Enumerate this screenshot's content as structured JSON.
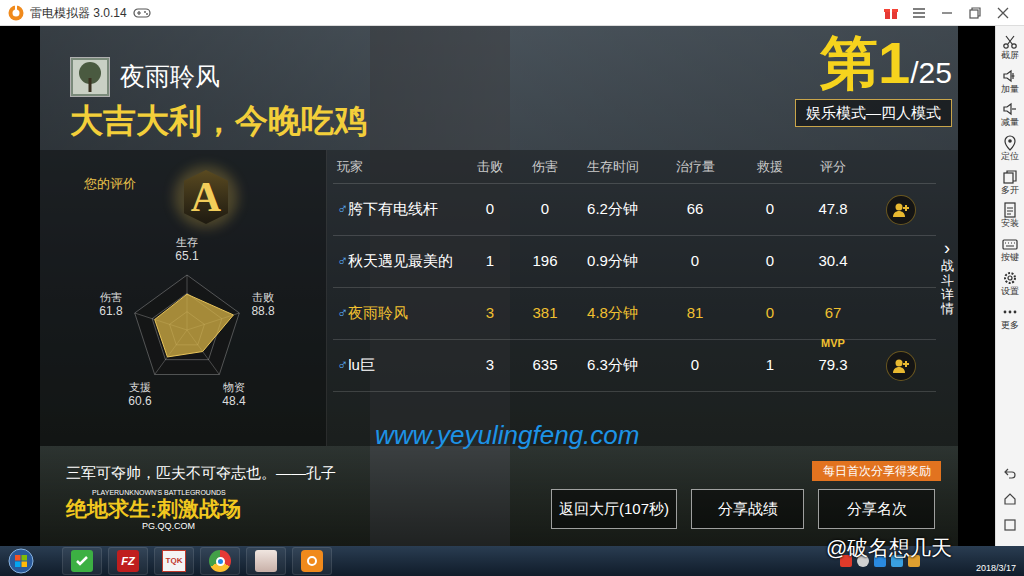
{
  "emulator": {
    "title": "雷电模拟器 3.0.14",
    "sidebar": [
      {
        "label": "截屏",
        "kind": "scissors"
      },
      {
        "label": "加量",
        "kind": "volup"
      },
      {
        "label": "减量",
        "kind": "voldown"
      },
      {
        "label": "定位",
        "kind": "location"
      },
      {
        "label": "多开",
        "kind": "multi"
      },
      {
        "label": "安装",
        "kind": "apk"
      },
      {
        "label": "按键",
        "kind": "keyboard"
      },
      {
        "label": "设置",
        "kind": "gear"
      },
      {
        "label": "更多",
        "kind": "more"
      }
    ]
  },
  "header": {
    "player": "夜雨聆风",
    "slogan": "大吉大利，今晚吃鸡",
    "rank": "第1",
    "total": "/25",
    "mode": "娱乐模式—四人模式"
  },
  "rating": {
    "title": "您的评价",
    "grade": "A",
    "stats": [
      {
        "label": "生存",
        "reading": "65.1",
        "value": 65.1
      },
      {
        "label": "击败",
        "reading": "88.8",
        "value": 88.8
      },
      {
        "label": "物资",
        "reading": "48.4",
        "value": 48.4
      },
      {
        "label": "支援",
        "reading": "60.6",
        "value": 60.6
      },
      {
        "label": "伤害",
        "reading": "61.8",
        "value": 61.8
      }
    ]
  },
  "table": {
    "columns": [
      "玩家",
      "击败",
      "伤害",
      "生存时间",
      "治疗量",
      "救援",
      "评分"
    ],
    "rows": [
      {
        "gender": "♂",
        "name": "胯下有电线杆",
        "cells": [
          "0",
          "0",
          "6.2分钟",
          "66",
          "0",
          "47.8"
        ],
        "self": false,
        "mvp": false,
        "add_friend": true
      },
      {
        "gender": "♂",
        "name": "秋天遇见最美的",
        "cells": [
          "1",
          "196",
          "0.9分钟",
          "0",
          "0",
          "30.4"
        ],
        "self": false,
        "mvp": false,
        "add_friend": false
      },
      {
        "gender": "♂",
        "name": "夜雨聆风",
        "cells": [
          "3",
          "381",
          "4.8分钟",
          "81",
          "0",
          "67"
        ],
        "self": true,
        "mvp": false,
        "add_friend": false
      },
      {
        "gender": "♂",
        "name": "lu巨",
        "cells": [
          "3",
          "635",
          "6.3分钟",
          "0",
          "1",
          "79.3"
        ],
        "self": false,
        "mvp": true,
        "add_friend": true
      }
    ],
    "mvp_label": "MVP",
    "details_arrow": "›",
    "details": "战斗详情"
  },
  "watermark": "www.yeyulingfeng.com",
  "footer": {
    "quote": "三军可夺帅，匹夫不可夺志也。——孔子",
    "logo_en": "PLAYERUNKNOWN'S BATTLEGROUNDS",
    "logo_cn": "绝地求生:刺激战场",
    "logo_url": "PG.QQ.COM",
    "buttons": [
      {
        "label": "返回大厅(107秒)"
      },
      {
        "label": "分享战绩"
      },
      {
        "label": "分享名次",
        "tag": "每日首次分享得奖励"
      }
    ]
  },
  "taskbar": {
    "apps": [
      {
        "kind": "check"
      },
      {
        "kind": "filezilla",
        "label": "FZ"
      },
      {
        "kind": "tqk",
        "label": "TQK"
      },
      {
        "kind": "chrome"
      },
      {
        "kind": "avatar"
      },
      {
        "kind": "ldplayer"
      }
    ],
    "date": "2018/3/17"
  },
  "weibo_watermark": "@破名想几天"
}
